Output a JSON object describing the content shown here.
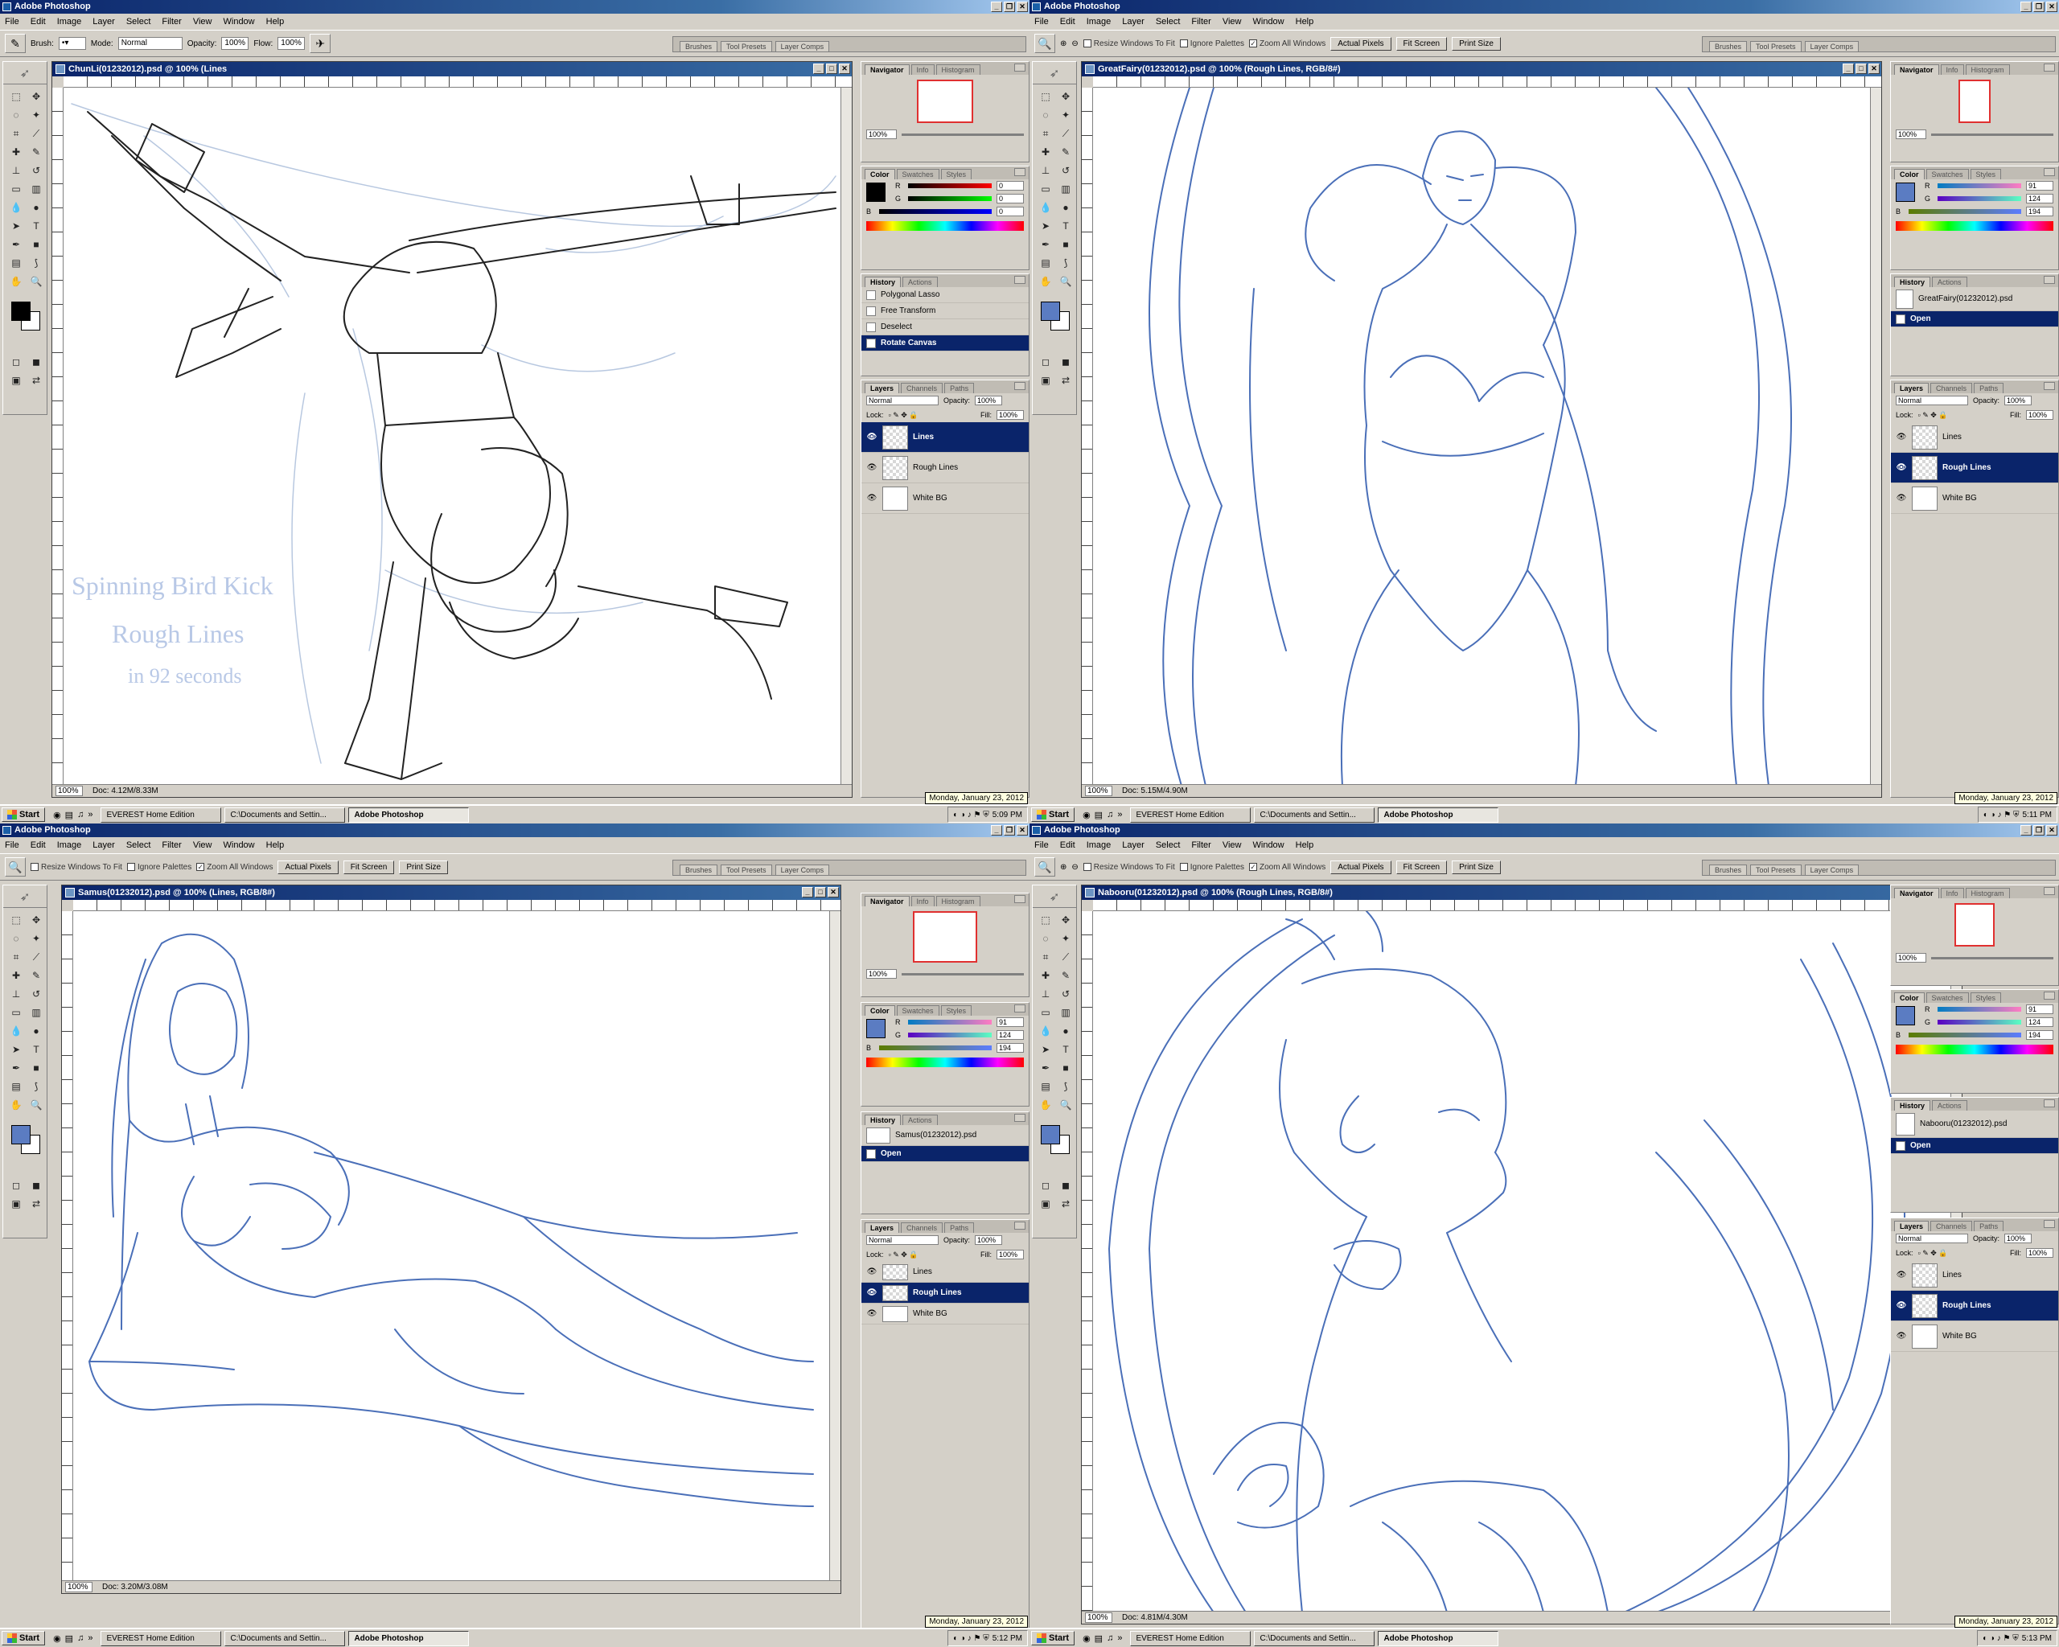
{
  "app_title": "Adobe Photoshop",
  "menu": [
    "File",
    "Edit",
    "Image",
    "Layer",
    "Select",
    "Filter",
    "View",
    "Window",
    "Help"
  ],
  "palette_well": [
    "Brushes",
    "Tool Presets",
    "Layer Comps"
  ],
  "options_brush": {
    "brush_label": "Brush:",
    "mode_label": "Mode:",
    "mode": "Normal",
    "opacity_label": "Opacity:",
    "opacity": "100%",
    "flow_label": "Flow:",
    "flow": "100%"
  },
  "options_zoom": {
    "resize": "Resize Windows To Fit",
    "ignore": "Ignore Palettes",
    "zoom_all": "Zoom All Windows",
    "actual": "Actual Pixels",
    "fit": "Fit Screen",
    "print": "Print Size"
  },
  "panels": {
    "navigator_tabs": [
      "Navigator",
      "Info",
      "Histogram"
    ],
    "color_tabs": [
      "Color",
      "Swatches",
      "Styles"
    ],
    "history_tabs": [
      "History",
      "Actions"
    ],
    "layers_tabs": [
      "Layers",
      "Channels",
      "Paths"
    ],
    "blend": "Normal",
    "opacity_label": "Opacity:",
    "opacity": "100%",
    "lock_label": "Lock:",
    "fill_label": "Fill:",
    "fill": "100%",
    "nav_zoom": "100%",
    "labels_rgb": [
      "R",
      "G",
      "B"
    ]
  },
  "taskbar": {
    "start": "Start",
    "tasks": [
      "EVEREST Home Edition",
      "C:\\Documents and Settin...",
      "Adobe Photoshop"
    ],
    "date_tooltip": "Monday, January 23, 2012"
  },
  "screens": [
    {
      "doc_title": "ChunLi(01232012).psd @ 100% (Lines",
      "zoom": "100%",
      "doc_size": "Doc: 4.12M/8.33M",
      "fg_color": "#000000",
      "rgb": [
        "0",
        "0",
        "0"
      ],
      "history": [
        "Polygonal Lasso",
        "Free Transform",
        "Deselect",
        "Rotate Canvas"
      ],
      "history_selected": 3,
      "layers": [
        "Lines",
        "Rough Lines",
        "White BG"
      ],
      "layer_selected": 0,
      "clock": "5:09 PM",
      "note": [
        "Spinning Bird Kick",
        "Rough Lines",
        "in  92  seconds"
      ]
    },
    {
      "doc_title": "GreatFairy(01232012).psd @ 100% (Rough Lines, RGB/8#)",
      "zoom": "100%",
      "doc_size": "Doc: 5.15M/4.90M",
      "fg_color": "#5b7cc2",
      "rgb": [
        "91",
        "124",
        "194"
      ],
      "history": [
        "GreatFairy(01232012).psd",
        "Open"
      ],
      "history_selected": 1,
      "layers": [
        "Lines",
        "Rough Lines",
        "White BG"
      ],
      "layer_selected": 1,
      "clock": "5:11 PM"
    },
    {
      "doc_title": "Samus(01232012).psd @ 100% (Lines, RGB/8#)",
      "zoom": "100%",
      "doc_size": "Doc: 3.20M/3.08M",
      "fg_color": "#5b7cc2",
      "rgb": [
        "91",
        "124",
        "194"
      ],
      "history": [
        "Samus(01232012).psd",
        "Open"
      ],
      "history_selected": 1,
      "layers": [
        "Lines",
        "Rough Lines",
        "White BG"
      ],
      "layer_selected": 1,
      "clock": "5:12 PM"
    },
    {
      "doc_title": "Nabooru(01232012).psd @ 100% (Rough Lines, RGB/8#)",
      "zoom": "100%",
      "doc_size": "Doc: 4.81M/4.30M",
      "fg_color": "#5b7cc2",
      "rgb": [
        "91",
        "124",
        "194"
      ],
      "history": [
        "Nabooru(01232012).psd",
        "Open"
      ],
      "history_selected": 1,
      "layers": [
        "Lines",
        "Rough Lines",
        "White BG"
      ],
      "layer_selected": 1,
      "clock": "5:13 PM"
    }
  ]
}
